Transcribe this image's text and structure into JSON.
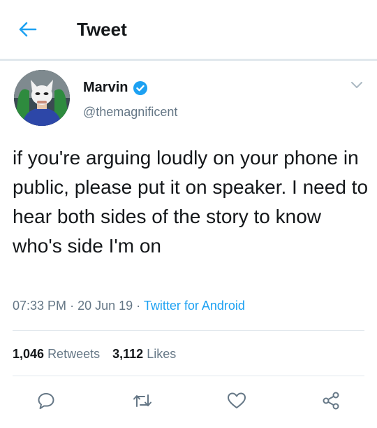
{
  "header": {
    "title": "Tweet",
    "back_icon": "arrow-left-icon"
  },
  "author": {
    "name": "Marvin",
    "handle": "@themagnificent",
    "verified_icon": "verified-badge-icon"
  },
  "tweet": {
    "text": "if you're arguing loudly on your phone in public, please put it on speaker. I need to hear both sides of the story to know who's side I'm on",
    "time": "07:33 PM",
    "separator": "·",
    "date": "20 Jun 19",
    "source": "Twitter for Android"
  },
  "stats": {
    "retweets_count": "1,046",
    "retweets_label": "Retweets",
    "likes_count": "3,112",
    "likes_label": "Likes"
  },
  "actions": [
    "reply-icon",
    "retweet-icon",
    "like-icon",
    "share-icon"
  ],
  "colors": {
    "accent": "#1da1f2",
    "muted": "#657786",
    "text": "#14171a",
    "divider": "#e1e8ed"
  }
}
